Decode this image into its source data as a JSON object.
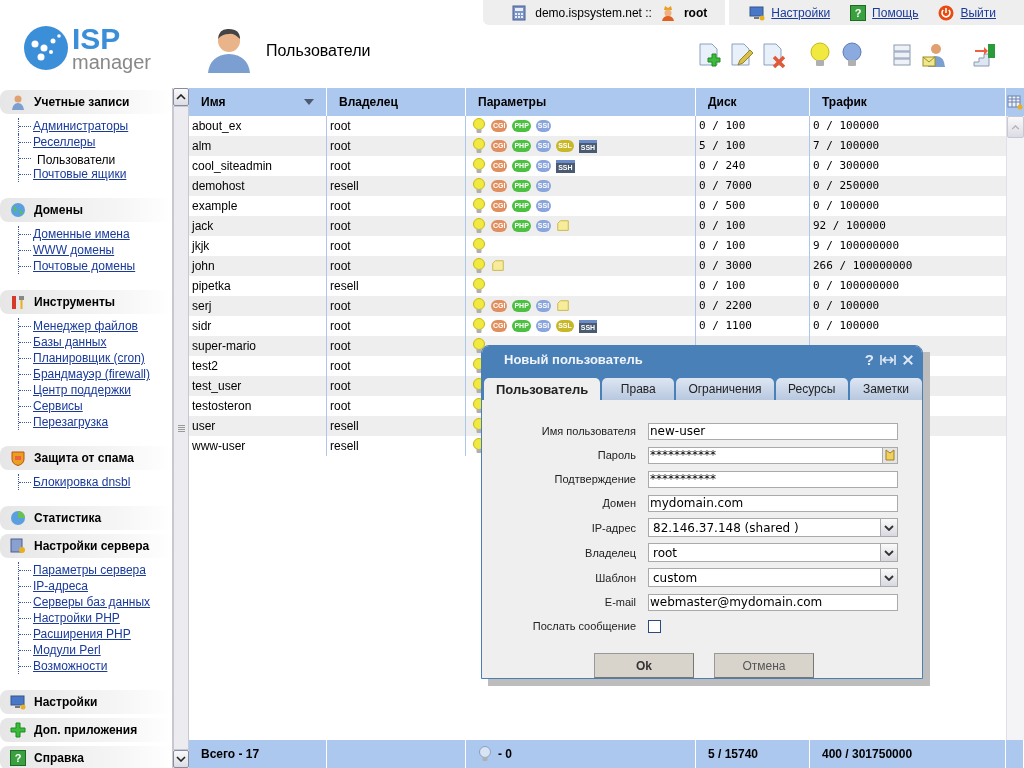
{
  "logo": {
    "title": "ISP",
    "subtitle": "manager"
  },
  "top_bar": {
    "server": "demo.ispsystem.net ::",
    "user": "root",
    "links": [
      {
        "kind": "settings",
        "label": "Настройки"
      },
      {
        "kind": "help",
        "label": "Помощь",
        "icon_glyph": "?"
      },
      {
        "kind": "logout",
        "label": "Выйти"
      }
    ]
  },
  "page": {
    "title": "Пользователи"
  },
  "toolbar": [
    {
      "kind": "add"
    },
    {
      "kind": "edit"
    },
    {
      "kind": "delete"
    },
    {
      "kind": "bulb-on"
    },
    {
      "kind": "bulb-off"
    },
    {
      "kind": "list"
    },
    {
      "kind": "mail-user"
    },
    {
      "kind": "enter"
    }
  ],
  "sidebar": [
    {
      "kind": "accounts",
      "title": "Учетные записи",
      "items": [
        {
          "label": "Администраторы",
          "selected": false
        },
        {
          "label": "Реселлеры",
          "selected": false
        },
        {
          "label": "Пользователи",
          "selected": true
        },
        {
          "label": "Почтовые ящики",
          "selected": false
        }
      ]
    },
    {
      "kind": "domains",
      "title": "Домены",
      "items": [
        {
          "label": "Доменные имена",
          "selected": false
        },
        {
          "label": "WWW домены",
          "selected": false
        },
        {
          "label": "Почтовые домены",
          "selected": false
        }
      ]
    },
    {
      "kind": "tools",
      "title": "Инструменты",
      "items": [
        {
          "label": "Менеджер файлов",
          "selected": false
        },
        {
          "label": "Базы данных",
          "selected": false
        },
        {
          "label": "Планировщик (cron)",
          "selected": false
        },
        {
          "label": "Брандмауэр (firewall)",
          "selected": false
        },
        {
          "label": "Центр поддержки",
          "selected": false
        },
        {
          "label": "Сервисы",
          "selected": false
        },
        {
          "label": "Перезагрузка",
          "selected": false
        }
      ]
    },
    {
      "kind": "spam",
      "title": "Защита от спама",
      "items": [
        {
          "label": "Блокировка dnsbl",
          "selected": false
        }
      ]
    },
    {
      "kind": "stats",
      "title": "Статистика"
    },
    {
      "kind": "server",
      "title": "Настройки сервера",
      "items": [
        {
          "label": "Параметры сервера",
          "selected": false
        },
        {
          "label": "IP-адреса",
          "selected": false
        },
        {
          "label": "Серверы баз данных",
          "selected": false
        },
        {
          "label": "Настройки PHP",
          "selected": false
        },
        {
          "label": "Расширения PHP",
          "selected": false
        },
        {
          "label": "Модули Perl",
          "selected": false
        },
        {
          "label": "Возможности",
          "selected": false
        }
      ]
    },
    {
      "kind": "settings",
      "title": "Настройки"
    },
    {
      "kind": "apps",
      "title": "Доп. приложения"
    },
    {
      "kind": "help",
      "title": "Справка",
      "icon_glyph": "?"
    }
  ],
  "table": {
    "columns": [
      "Имя",
      "Владелец",
      "Параметры",
      "Диск",
      "Трафик"
    ],
    "rows": [
      {
        "name": "about_ex",
        "owner": "root",
        "params": [
          {
            "kind": "bulb"
          },
          {
            "kind": "badge",
            "label": "CGI",
            "color": "#e09060"
          },
          {
            "kind": "badge",
            "label": "PHP",
            "color": "#4cc040"
          },
          {
            "kind": "badge",
            "label": "SSI",
            "color": "#8aa4dc"
          }
        ],
        "disk": "0 / 100",
        "traffic": "0 / 100000"
      },
      {
        "name": "alm",
        "owner": "root",
        "params": [
          {
            "kind": "bulb"
          },
          {
            "kind": "badge",
            "label": "CGI",
            "color": "#e09060"
          },
          {
            "kind": "badge",
            "label": "PHP",
            "color": "#4cc040"
          },
          {
            "kind": "badge",
            "label": "SSI",
            "color": "#8aa4dc"
          },
          {
            "kind": "badge",
            "label": "SSL",
            "color": "#c8b828"
          },
          {
            "kind": "ssh",
            "label": "SSH"
          }
        ],
        "disk": "5 / 100",
        "traffic": "7 / 100000"
      },
      {
        "name": "cool_siteadmin",
        "owner": "root",
        "params": [
          {
            "kind": "bulb"
          },
          {
            "kind": "badge",
            "label": "CGI",
            "color": "#e09060"
          },
          {
            "kind": "badge",
            "label": "PHP",
            "color": "#4cc040"
          },
          {
            "kind": "badge",
            "label": "SSI",
            "color": "#8aa4dc"
          },
          {
            "kind": "ssh",
            "label": "SSH"
          }
        ],
        "disk": "0 / 240",
        "traffic": "0 / 300000"
      },
      {
        "name": "demohost",
        "owner": "resell",
        "params": [
          {
            "kind": "bulb"
          },
          {
            "kind": "badge",
            "label": "CGI",
            "color": "#e09060"
          },
          {
            "kind": "badge",
            "label": "PHP",
            "color": "#4cc040"
          },
          {
            "kind": "badge",
            "label": "SSI",
            "color": "#8aa4dc"
          }
        ],
        "disk": "0 / 7000",
        "traffic": "0 / 250000"
      },
      {
        "name": "example",
        "owner": "root",
        "params": [
          {
            "kind": "bulb"
          },
          {
            "kind": "badge",
            "label": "CGI",
            "color": "#e09060"
          },
          {
            "kind": "badge",
            "label": "PHP",
            "color": "#4cc040"
          },
          {
            "kind": "badge",
            "label": "SSI",
            "color": "#8aa4dc"
          }
        ],
        "disk": "0 / 500",
        "traffic": "0 / 100000"
      },
      {
        "name": "jack",
        "owner": "root",
        "params": [
          {
            "kind": "bulb"
          },
          {
            "kind": "badge",
            "label": "CGI",
            "color": "#e09060"
          },
          {
            "kind": "badge",
            "label": "PHP",
            "color": "#4cc040"
          },
          {
            "kind": "badge",
            "label": "SSI",
            "color": "#8aa4dc"
          },
          {
            "kind": "note"
          }
        ],
        "disk": "0 / 100",
        "traffic": "92 / 100000"
      },
      {
        "name": "jkjk",
        "owner": "root",
        "params": [
          {
            "kind": "bulb"
          }
        ],
        "disk": "0 / 100",
        "traffic": "9 / 100000000"
      },
      {
        "name": "john",
        "owner": "root",
        "params": [
          {
            "kind": "bulb"
          },
          {
            "kind": "note"
          }
        ],
        "disk": "0 / 3000",
        "traffic": "266 / 100000000"
      },
      {
        "name": "pipetka",
        "owner": "resell",
        "params": [
          {
            "kind": "bulb"
          }
        ],
        "disk": "0 / 100",
        "traffic": "0 / 100000000"
      },
      {
        "name": "serj",
        "owner": "root",
        "params": [
          {
            "kind": "bulb"
          },
          {
            "kind": "badge",
            "label": "CGI",
            "color": "#e09060"
          },
          {
            "kind": "badge",
            "label": "PHP",
            "color": "#4cc040"
          },
          {
            "kind": "badge",
            "label": "SSI",
            "color": "#8aa4dc"
          },
          {
            "kind": "note"
          }
        ],
        "disk": "0 / 2200",
        "traffic": "0 / 100000"
      },
      {
        "name": "sidr",
        "owner": "root",
        "params": [
          {
            "kind": "bulb"
          },
          {
            "kind": "badge",
            "label": "CGI",
            "color": "#e09060"
          },
          {
            "kind": "badge",
            "label": "PHP",
            "color": "#4cc040"
          },
          {
            "kind": "badge",
            "label": "SSI",
            "color": "#8aa4dc"
          },
          {
            "kind": "badge",
            "label": "SSL",
            "color": "#c8b828"
          },
          {
            "kind": "ssh",
            "label": "SSH"
          }
        ],
        "disk": "0 / 1100",
        "traffic": "0 / 100000"
      },
      {
        "name": "super-mario",
        "owner": "root",
        "params": [
          {
            "kind": "bulb"
          }
        ]
      },
      {
        "name": "test2",
        "owner": "root",
        "params": [
          {
            "kind": "bulb"
          }
        ]
      },
      {
        "name": "test_user",
        "owner": "root",
        "params": [
          {
            "kind": "bulb"
          }
        ]
      },
      {
        "name": "testosteron",
        "owner": "root",
        "params": [
          {
            "kind": "bulb"
          }
        ]
      },
      {
        "name": "user",
        "owner": "resell",
        "params": [
          {
            "kind": "bulb"
          }
        ]
      },
      {
        "name": "www-user",
        "owner": "resell",
        "params": [
          {
            "kind": "bulb"
          }
        ]
      }
    ],
    "footer": {
      "total": "Всего - 17",
      "disabled": "- 0",
      "disk": "5 / 15740",
      "traffic": "400 / 301750000"
    }
  },
  "dialog": {
    "title": "Новый пользователь",
    "help_glyph": "?",
    "tabs": [
      {
        "label": "Пользователь",
        "selected": true
      },
      {
        "label": "Права",
        "selected": false
      },
      {
        "label": "Ограничения",
        "selected": false
      },
      {
        "label": "Ресурсы",
        "selected": false
      },
      {
        "label": "Заметки",
        "selected": false
      }
    ],
    "fields": [
      {
        "kind": "text",
        "label": "Имя пользователя",
        "value": "new-user"
      },
      {
        "kind": "password",
        "label": "Пароль",
        "value": "***********"
      },
      {
        "kind": "text",
        "label": "Подтверждение",
        "value": "***********"
      },
      {
        "kind": "text",
        "label": "Домен",
        "value": "mydomain.com"
      },
      {
        "kind": "select",
        "label": "IP-адрес",
        "value": "82.146.37.148 (shared )"
      },
      {
        "kind": "select",
        "label": "Владелец",
        "value": "root"
      },
      {
        "kind": "select",
        "label": "Шаблон",
        "value": "custom"
      },
      {
        "kind": "text",
        "label": "E-mail",
        "value": "webmaster@mydomain.com"
      },
      {
        "kind": "checkbox",
        "label": "Послать сообщение",
        "checked": false
      }
    ],
    "buttons": [
      "Ok",
      "Отмена"
    ]
  }
}
